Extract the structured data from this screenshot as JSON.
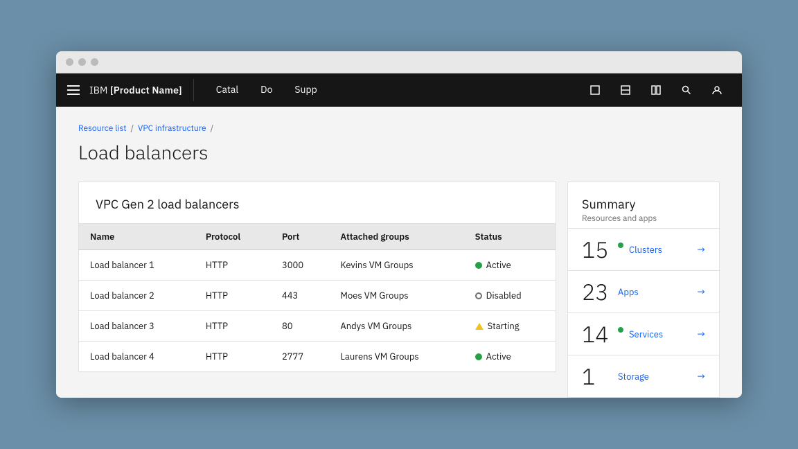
{
  "browser": {
    "dots": [
      "dot1",
      "dot2",
      "dot3"
    ]
  },
  "nav": {
    "brand": "IBM ",
    "product": "[Product Name]",
    "links": [
      {
        "label": "Catal",
        "id": "catalog"
      },
      {
        "label": "Do",
        "id": "docs"
      },
      {
        "label": "Supp",
        "id": "support"
      }
    ]
  },
  "breadcrumb": {
    "items": [
      {
        "label": "Resource list",
        "link": true
      },
      {
        "label": "VPC infrastructure",
        "link": true
      },
      {
        "label": "",
        "link": false
      }
    ],
    "separator": "/"
  },
  "page": {
    "title": "Load balancers"
  },
  "table": {
    "section_title": "VPC Gen 2 load balancers",
    "columns": [
      "Name",
      "Protocol",
      "Port",
      "Attached groups",
      "Status"
    ],
    "rows": [
      {
        "name": "Load balancer 1",
        "protocol": "HTTP",
        "port": "3000",
        "groups": "Kevins VM Groups",
        "status": "Active",
        "status_type": "active"
      },
      {
        "name": "Load balancer 2",
        "protocol": "HTTP",
        "port": "443",
        "groups": "Moes VM Groups",
        "status": "Disabled",
        "status_type": "disabled"
      },
      {
        "name": "Load balancer 3",
        "protocol": "HTTP",
        "port": "80",
        "groups": "Andys VM Groups",
        "status": "Starting",
        "status_type": "starting"
      },
      {
        "name": "Load balancer 4",
        "protocol": "HTTP",
        "port": "2777",
        "groups": "Laurens VM Groups",
        "status": "Active",
        "status_type": "active"
      }
    ]
  },
  "summary": {
    "title": "Summary",
    "subtitle": "Resources and apps",
    "items": [
      {
        "count": "15",
        "has_dot": true,
        "dot_color": "green",
        "label": "Clusters",
        "id": "clusters"
      },
      {
        "count": "23",
        "has_dot": false,
        "dot_color": null,
        "label": "Apps",
        "id": "apps"
      },
      {
        "count": "14",
        "has_dot": true,
        "dot_color": "green",
        "label": "Services",
        "id": "services"
      },
      {
        "count": "1",
        "has_dot": false,
        "dot_color": null,
        "label": "Storage",
        "id": "storage"
      }
    ]
  },
  "colors": {
    "active": "#24a148",
    "disabled": "#6f6f6f",
    "starting": "#f1c21b",
    "link": "#0f62fe"
  }
}
